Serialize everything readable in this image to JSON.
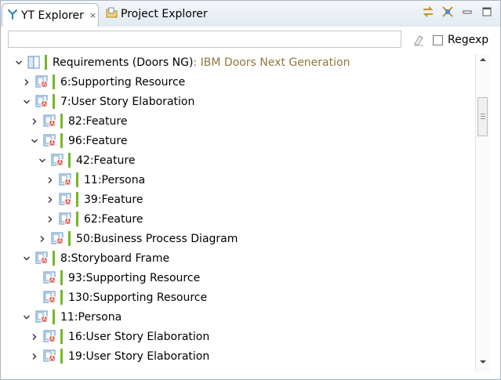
{
  "tabs": [
    {
      "label": "YT Explorer",
      "active": true,
      "icon": "yt-explorer-icon",
      "close": "×"
    },
    {
      "label": "Project Explorer",
      "active": false,
      "icon": "project-explorer-icon"
    }
  ],
  "view_tools": [
    {
      "name": "link-with-editor-icon"
    },
    {
      "name": "collapse-all-icon"
    },
    {
      "name": "minimize-icon"
    },
    {
      "name": "maximize-icon"
    }
  ],
  "filter": {
    "value": "",
    "placeholder": ""
  },
  "regexp": {
    "label": "Regexp",
    "checked": false
  },
  "colors": {
    "accent_bar": "#76b82a",
    "description_text": "#8f7742"
  },
  "tree": [
    {
      "label": "Requirements (Doors NG)",
      "desc": " : IBM Doors Next Generation",
      "depth": 0,
      "state": "expanded",
      "kind": "root"
    },
    {
      "label": "6:Supporting Resource",
      "depth": 1,
      "state": "collapsed"
    },
    {
      "label": "7:User Story Elaboration",
      "depth": 1,
      "state": "expanded"
    },
    {
      "label": "82:Feature",
      "depth": 2,
      "state": "collapsed"
    },
    {
      "label": "96:Feature",
      "depth": 2,
      "state": "expanded"
    },
    {
      "label": "42:Feature",
      "depth": 3,
      "state": "expanded"
    },
    {
      "label": "11:Persona",
      "depth": 4,
      "state": "collapsed"
    },
    {
      "label": "39:Feature",
      "depth": 4,
      "state": "collapsed"
    },
    {
      "label": "62:Feature",
      "depth": 4,
      "state": "collapsed"
    },
    {
      "label": "50:Business Process Diagram",
      "depth": 3,
      "state": "collapsed"
    },
    {
      "label": "8:Storyboard Frame",
      "depth": 1,
      "state": "expanded"
    },
    {
      "label": "93:Supporting Resource",
      "depth": 2,
      "state": "leaf"
    },
    {
      "label": "130:Supporting Resource",
      "depth": 2,
      "state": "leaf"
    },
    {
      "label": "11:Persona",
      "depth": 1,
      "state": "expanded"
    },
    {
      "label": "16:User Story Elaboration",
      "depth": 2,
      "state": "collapsed"
    },
    {
      "label": "19:User Story Elaboration",
      "depth": 2,
      "state": "collapsed"
    }
  ]
}
